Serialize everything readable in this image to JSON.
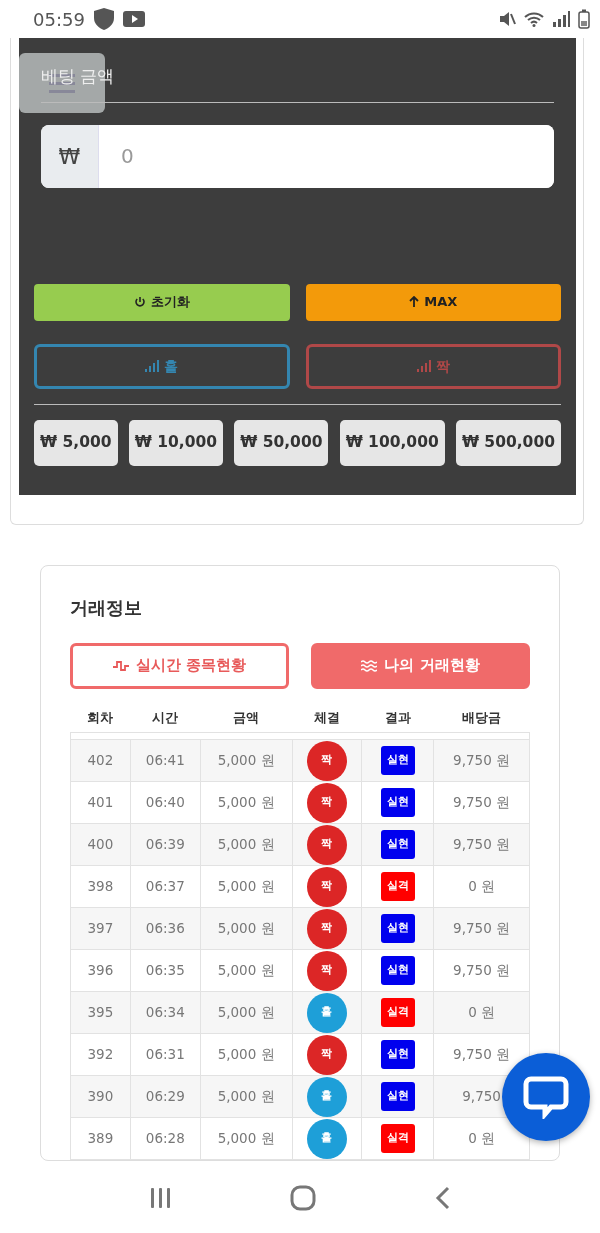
{
  "status_bar": {
    "time": "05:59"
  },
  "bet_panel": {
    "title": "베팅 금액",
    "currency": "₩",
    "amount_placeholder": "0",
    "actions": [
      {
        "label": "초기화",
        "kind": "reset",
        "color": "#97cc4f"
      },
      {
        "label": "MAX",
        "kind": "max",
        "color": "#f39a0a"
      }
    ],
    "choices": [
      {
        "label": "홀",
        "color": "#3486b0",
        "disabled": true
      },
      {
        "label": "짝",
        "color": "#b04848",
        "disabled": true
      }
    ],
    "chips": [
      "₩ 5,000",
      "₩ 10,000",
      "₩ 50,000",
      "₩ 100,000",
      "₩ 500,000"
    ]
  },
  "trade_info": {
    "title": "거래정보",
    "tabs": [
      {
        "label": "실시간 종목현황",
        "kind": "pulse",
        "selected": false
      },
      {
        "label": "나의 거래현황",
        "kind": "lines",
        "selected": true
      }
    ],
    "columns": [
      "회차",
      "시간",
      "금액",
      "체결",
      "결과",
      "배당금"
    ],
    "rows": [
      {
        "round": "402",
        "time": "06:41",
        "amount": "5,000 원",
        "pick": {
          "label": "짝",
          "color": "#dc2626"
        },
        "result": {
          "label": "실현",
          "color": "#0000ee"
        },
        "payout": "9,750 원"
      },
      {
        "round": "401",
        "time": "06:40",
        "amount": "5,000 원",
        "pick": {
          "label": "짝",
          "color": "#dc2626"
        },
        "result": {
          "label": "실현",
          "color": "#0000ee"
        },
        "payout": "9,750 원"
      },
      {
        "round": "400",
        "time": "06:39",
        "amount": "5,000 원",
        "pick": {
          "label": "짝",
          "color": "#dc2626"
        },
        "result": {
          "label": "실현",
          "color": "#0000ee"
        },
        "payout": "9,750 원"
      },
      {
        "round": "398",
        "time": "06:37",
        "amount": "5,000 원",
        "pick": {
          "label": "짝",
          "color": "#dc2626"
        },
        "result": {
          "label": "실격",
          "color": "#ff0000"
        },
        "payout": "0 원"
      },
      {
        "round": "397",
        "time": "06:36",
        "amount": "5,000 원",
        "pick": {
          "label": "짝",
          "color": "#dc2626"
        },
        "result": {
          "label": "실현",
          "color": "#0000ee"
        },
        "payout": "9,750 원"
      },
      {
        "round": "396",
        "time": "06:35",
        "amount": "5,000 원",
        "pick": {
          "label": "짝",
          "color": "#dc2626"
        },
        "result": {
          "label": "실현",
          "color": "#0000ee"
        },
        "payout": "9,750 원"
      },
      {
        "round": "395",
        "time": "06:34",
        "amount": "5,000 원",
        "pick": {
          "label": "홀",
          "color": "#1e9fd8"
        },
        "result": {
          "label": "실격",
          "color": "#ff0000"
        },
        "payout": "0 원"
      },
      {
        "round": "392",
        "time": "06:31",
        "amount": "5,000 원",
        "pick": {
          "label": "짝",
          "color": "#dc2626"
        },
        "result": {
          "label": "실현",
          "color": "#0000ee"
        },
        "payout": "9,750 원"
      },
      {
        "round": "390",
        "time": "06:29",
        "amount": "5,000 원",
        "pick": {
          "label": "홀",
          "color": "#1e9fd8"
        },
        "result": {
          "label": "실현",
          "color": "#0000ee"
        },
        "payout": "9,750"
      },
      {
        "round": "389",
        "time": "06:28",
        "amount": "5,000 원",
        "pick": {
          "label": "홀",
          "color": "#1e9fd8"
        },
        "result": {
          "label": "실격",
          "color": "#ff0000"
        },
        "payout": "0 원"
      }
    ]
  }
}
